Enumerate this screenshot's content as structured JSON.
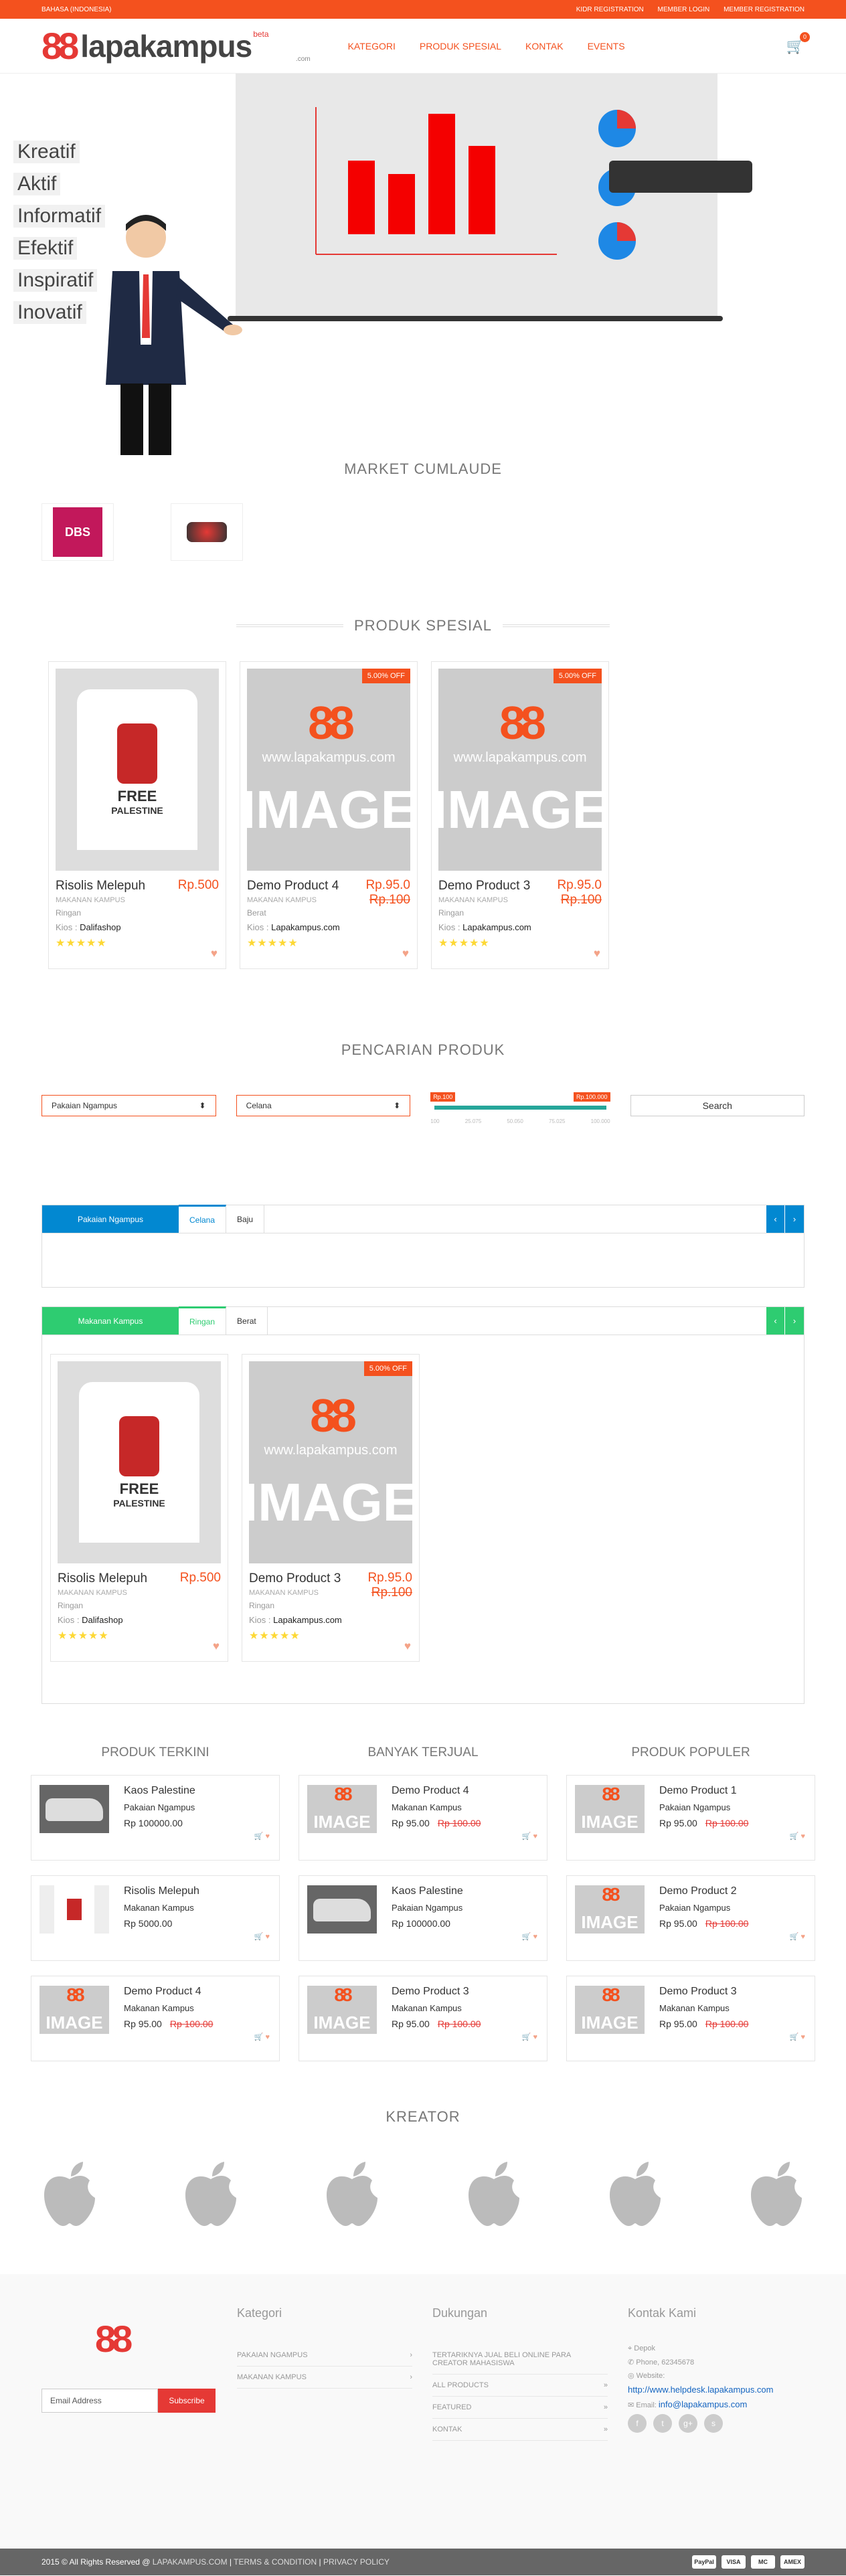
{
  "topbar": {
    "language": "BAHASA (INDONESIA)",
    "links": [
      "KIDR REGISTRATION",
      "MEMBER LOGIN",
      "MEMBER REGISTRATION"
    ]
  },
  "header": {
    "logo_word": "lapakampus",
    "beta": "beta",
    "com": ".com",
    "nav": [
      "KATEGORI",
      "PRODUK SPESIAL",
      "KONTAK",
      "EVENTS"
    ],
    "cart_count": "0"
  },
  "hero": {
    "words": [
      "Kreatif",
      "Aktif",
      "Informatif",
      "Efektif",
      "Inspiratif",
      "Inovatif"
    ]
  },
  "market": {
    "title": "MARKET CUMLAUDE"
  },
  "special": {
    "title": "PRODUK SPESIAL",
    "items": [
      {
        "name": "Risolis Melepuh",
        "price": "Rp.500",
        "old": "",
        "category": "MAKANAN KAMPUS",
        "meta": "Ringan",
        "kios_label": "Kios :",
        "kios": "Dalifashop",
        "discount": "",
        "stars": "★★★★★"
      },
      {
        "name": "Demo Product 4",
        "price": "Rp.95.0",
        "old": "Rp.100",
        "category": "MAKANAN KAMPUS",
        "meta": "Berat",
        "kios_label": "Kios :",
        "kios": "Lapakampus.com",
        "discount": "5.00% OFF",
        "stars": "★★★★★"
      },
      {
        "name": "Demo Product 3",
        "price": "Rp.95.0",
        "old": "Rp.100",
        "category": "MAKANAN KAMPUS",
        "meta": "Ringan",
        "kios_label": "Kios :",
        "kios": "Lapakampus.com",
        "discount": "5.00% OFF",
        "stars": "★★★★★"
      }
    ]
  },
  "search": {
    "title": "PENCARIAN PRODUK",
    "category": "Pakaian Ngampus",
    "sub": "Celana",
    "price_min": "Rp.100",
    "price_max": "Rp.100.000",
    "ticks": [
      "100",
      "25.075",
      "50.050",
      "75.025",
      "100.000"
    ],
    "button": "Search"
  },
  "cat1": {
    "title": "Pakaian Ngampus",
    "tabs": [
      "Celana",
      "Baju"
    ],
    "color": "#0288d1"
  },
  "cat2": {
    "title": "Makanan Kampus",
    "tabs": [
      "Ringan",
      "Berat"
    ],
    "color": "#2ecc71",
    "items": [
      {
        "name": "Risolis Melepuh",
        "price": "Rp.500",
        "old": "",
        "category": "MAKANAN KAMPUS",
        "meta": "Ringan",
        "kios_label": "Kios :",
        "kios": "Dalifashop",
        "discount": "",
        "stars": "★★★★★"
      },
      {
        "name": "Demo Product 3",
        "price": "Rp.95.0",
        "old": "Rp.100",
        "category": "MAKANAN KAMPUS",
        "meta": "Ringan",
        "kios_label": "Kios :",
        "kios": "Lapakampus.com",
        "discount": "5.00% OFF",
        "stars": "★★★★★"
      }
    ]
  },
  "lists": [
    {
      "title": "PRODUK TERKINI",
      "items": [
        {
          "name": "Kaos Palestine",
          "cat": "Pakaian Ngampus",
          "price": "Rp 100000.00",
          "old": "",
          "thumb": "car"
        },
        {
          "name": "Risolis Melepuh",
          "cat": "Makanan Kampus",
          "price": "Rp 5000.00",
          "old": "",
          "thumb": "shirt"
        },
        {
          "name": "Demo Product 4",
          "cat": "Makanan Kampus",
          "price": "Rp 95.00",
          "old": "Rp 100.00",
          "thumb": "image"
        }
      ]
    },
    {
      "title": "BANYAK TERJUAL",
      "items": [
        {
          "name": "Demo Product 4",
          "cat": "Makanan Kampus",
          "price": "Rp 95.00",
          "old": "Rp 100.00",
          "thumb": "image"
        },
        {
          "name": "Kaos Palestine",
          "cat": "Pakaian Ngampus",
          "price": "Rp 100000.00",
          "old": "",
          "thumb": "car"
        },
        {
          "name": "Demo Product 3",
          "cat": "Makanan Kampus",
          "price": "Rp 95.00",
          "old": "Rp 100.00",
          "thumb": "image"
        }
      ]
    },
    {
      "title": "PRODUK POPULER",
      "items": [
        {
          "name": "Demo Product 1",
          "cat": "Pakaian Ngampus",
          "price": "Rp 95.00",
          "old": "Rp 100.00",
          "thumb": "image"
        },
        {
          "name": "Demo Product 2",
          "cat": "Pakaian Ngampus",
          "price": "Rp 95.00",
          "old": "Rp 100.00",
          "thumb": "image"
        },
        {
          "name": "Demo Product 3",
          "cat": "Makanan Kampus",
          "price": "Rp 95.00",
          "old": "Rp 100.00",
          "thumb": "image"
        }
      ]
    }
  ],
  "kreator": {
    "title": "KREATOR"
  },
  "footer": {
    "email_placeholder": "Email Address",
    "subscribe": "Subscribe",
    "kategori_title": "Kategori",
    "kategori": [
      "PAKAIAN NGAMPUS",
      "MAKANAN KAMPUS"
    ],
    "dukungan_title": "Dukungan",
    "dukungan": [
      "TERTARIKNYA JUAL BELI ONLINE PARA CREATOR MAHASISWA",
      "ALL PRODUCTS",
      "FEATURED",
      "KONTAK"
    ],
    "kontak_title": "Kontak Kami",
    "city": "Depok",
    "phone": "Phone, 62345678",
    "website_label": "Website:",
    "website": "http://www.helpdesk.lapakampus.com",
    "email_label": "Email:",
    "email": "info@lapakampus.com"
  },
  "bottom": {
    "copyright": "2015 © All Rights Reserved @",
    "links": [
      "LAPAKAMPUS.COM",
      "TERMS & CONDITION",
      "PRIVACY POLICY"
    ],
    "payments": [
      "PayPal",
      "VISA",
      "MC",
      "AMEX"
    ]
  }
}
